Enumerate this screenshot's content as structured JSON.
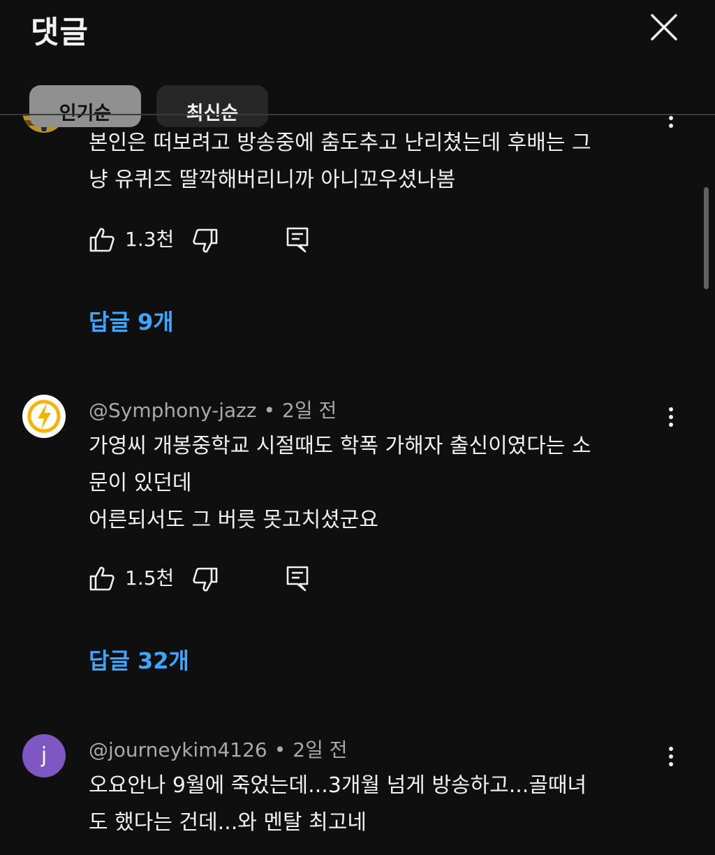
{
  "header": {
    "title": "댓글",
    "close_icon": "close-icon",
    "chips": [
      {
        "label": "인기순",
        "active": true
      },
      {
        "label": "최신순",
        "active": false
      }
    ]
  },
  "comments": [
    {
      "author": "",
      "time": "",
      "text_lines": [
        "본인은 떠보려고 방송중에 춤도추고 난리쳤는데 후배는 그",
        "냥 유퀴즈 딸깍해버리니까 아니꼬우셨나봄"
      ],
      "likes": "1.3천",
      "replies": "답글 9개",
      "avatar_icon": "photo-avatar"
    },
    {
      "author": "@Symphony-jazz",
      "time": "2일 전",
      "text_lines": [
        "가영씨 개봉중학교 시절때도 학폭 가해자 출신이였다는 소",
        "문이 있던데",
        "어른되서도 그 버릇 못고치셨군요"
      ],
      "likes": "1.5천",
      "replies": "답글 32개",
      "avatar_icon": "lightning-icon"
    },
    {
      "author": "@journeykim4126",
      "time": "2일 전",
      "text_lines": [
        "오요안나 9월에 죽었는데...3개월 넘게 방송하고...골때녀",
        "도 했다는 건데...와 멘탈 최고네"
      ],
      "avatar_letter": "j",
      "avatar_color": "#7e57c2"
    }
  ],
  "colors": {
    "background": "#0f0f0f",
    "link": "#3ea6ff",
    "muted": "#aaaaaa"
  }
}
